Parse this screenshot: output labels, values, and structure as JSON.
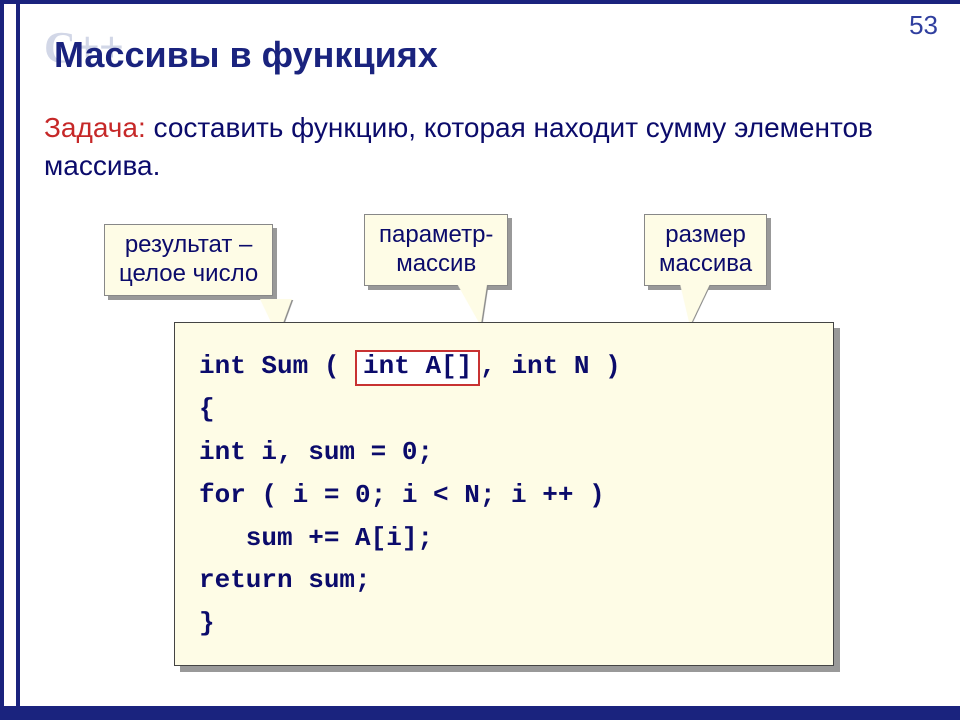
{
  "page_number": "53",
  "watermark": "C++",
  "title": "Массивы в функциях",
  "task": {
    "label": "Задача:",
    "text": " составить функцию, которая находит сумму элементов массива."
  },
  "callouts": {
    "c1_line1": "результат –",
    "c1_line2": "целое число",
    "c2_line1": "параметр-",
    "c2_line2": "массив",
    "c3_line1": "размер",
    "c3_line2": "массива"
  },
  "code": {
    "l1_before": "int Sum ( ",
    "l1_highlight": "int A[]",
    "l1_after": ", int N )",
    "l2": "{",
    "l3": "int i, sum = 0;",
    "l4": "for ( i = 0; i < N; i ++ )",
    "l5": "   sum += A[i];",
    "l6": "return sum;",
    "l7": "}"
  }
}
